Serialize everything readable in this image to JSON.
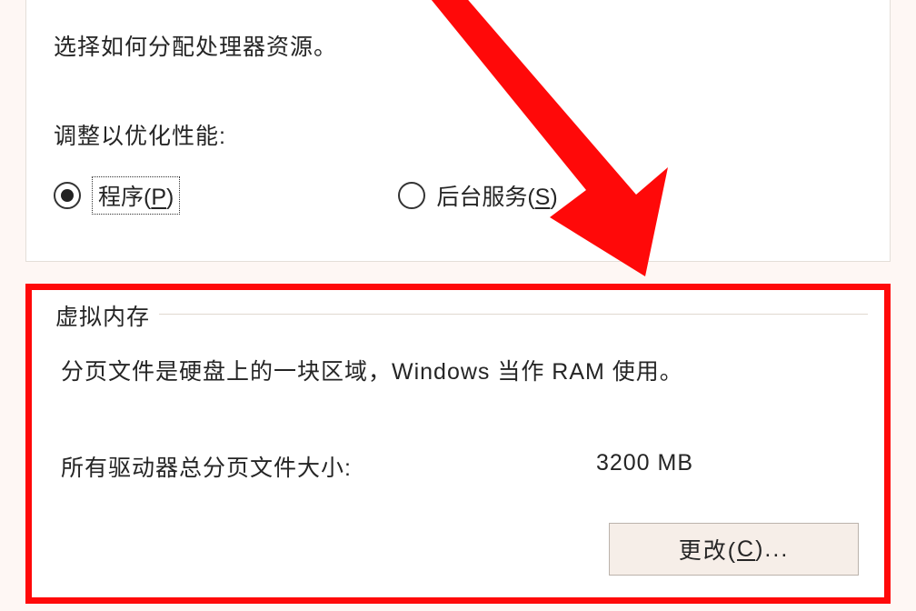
{
  "upper": {
    "description": "选择如何分配处理器资源。",
    "optimizeLabel": "调整以优化性能:",
    "radio1_prefix": "程序(",
    "radio1_key": "P",
    "radio1_suffix": ")",
    "radio2_prefix": "后台服务(",
    "radio2_key": "S",
    "radio2_suffix": ")"
  },
  "lower": {
    "legend": "虚拟内存",
    "description": "分页文件是硬盘上的一块区域，Windows 当作 RAM 使用。",
    "sizeLabel": "所有驱动器总分页文件大小:",
    "sizeValue": "3200 MB",
    "changeBtn_prefix": "更改(",
    "changeBtn_key": "C",
    "changeBtn_suffix": ")..."
  }
}
